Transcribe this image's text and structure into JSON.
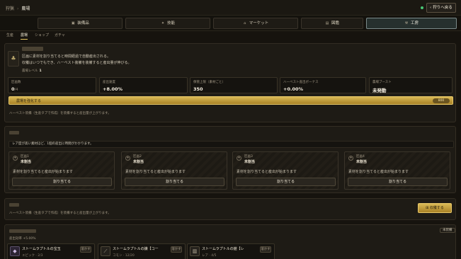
{
  "breadcrumb": {
    "parent": "狩猟",
    "separator": "›",
    "current": "農場"
  },
  "header": {
    "back_label": "狩りへ戻る",
    "back_icon": "chevron-left-icon"
  },
  "main_nav": [
    {
      "label": "装備品",
      "icon": "armor-icon",
      "active": false
    },
    {
      "label": "技能",
      "icon": "skill-icon",
      "active": false
    },
    {
      "label": "マーケット",
      "icon": "market-icon",
      "active": false
    },
    {
      "label": "図鑑",
      "icon": "book-icon",
      "active": false
    },
    {
      "label": "工房",
      "icon": "workshop-icon",
      "active": true
    }
  ],
  "sub_tabs": [
    {
      "label": "生産",
      "active": false
    },
    {
      "label": "農場",
      "active": true
    },
    {
      "label": "ショップ",
      "active": false
    },
    {
      "label": "ガチャ",
      "active": false
    }
  ],
  "farm": {
    "desc_line1": "区画に素材を割り当てると時間経過で自動産出される。",
    "desc_line2": "収穫はいつでもでき、ハーベスト装備を装備すると産出量が伸びる。",
    "level_label": "農場レベル",
    "level_value": "1",
    "stats": [
      {
        "label": "区画数",
        "value": "0",
        "suffix": "/4"
      },
      {
        "label": "産出速度",
        "value": "+8.00%",
        "suffix": ""
      },
      {
        "label": "保管上限（素材ごと）",
        "value": "350",
        "suffix": ""
      },
      {
        "label": "ハーベスト産出ボーナス",
        "value": "+0.00%",
        "suffix": ""
      },
      {
        "label": "農場ブースト",
        "value": "未発動",
        "suffix": ""
      }
    ],
    "upgrade_label": "農場を強化する",
    "upgrade_cost": "800",
    "note": "ハーベスト装備（生産タブで作成）を装備すると産出量が上がります。"
  },
  "plots": {
    "warning": "レア度が高い素材ほど、1個の産出に時間がかかります。",
    "items": [
      {
        "name": "区画1",
        "state": "未割当",
        "message": "素材を割り当てると産出が始まります",
        "button": "割り当てる"
      },
      {
        "name": "区画2",
        "state": "未割当",
        "message": "素材を割り当てると産出が始まります",
        "button": "割り当てる"
      },
      {
        "name": "区画3",
        "state": "未割当",
        "message": "素材を割り当てると産出が始まります",
        "button": "割り当てる"
      },
      {
        "name": "区画4",
        "state": "未割当",
        "message": "素材を割り当てると産出が始まります",
        "button": "割り当てる"
      }
    ]
  },
  "harvest": {
    "note": "ハーベスト装備（生産タブで作成）を装備すると産出量が上がります。",
    "collect_label": "収穫する",
    "collect_icon": "basket-icon"
  },
  "equipment": {
    "badge": "未装備",
    "bonus": "産出効率 +5.00%",
    "items": [
      {
        "name": "ストームラプトルの宝玉",
        "rarity": "エピック · 2/3",
        "action": "溶かす"
      },
      {
        "name": "ストームラプトルの鎌【コー",
        "rarity": "コモン · 12/20",
        "action": "溶かす"
      },
      {
        "name": "ストームラプトルの鎧【レ",
        "rarity": "レア · 4/5",
        "action": "溶かす"
      }
    ]
  },
  "colors": {
    "accent_gold": "#d9b955",
    "active_tab": "#7b8a8a",
    "status_green": "#48c774"
  }
}
